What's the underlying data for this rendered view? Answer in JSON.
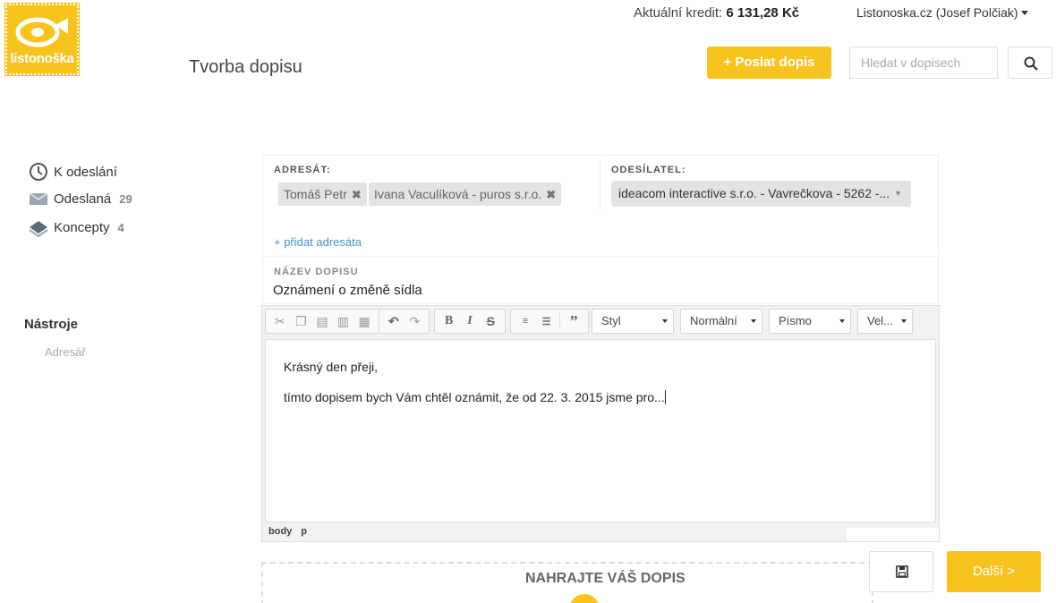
{
  "app": {
    "logo_text": "listonoška",
    "page_title": "Tvorba dopisu"
  },
  "header": {
    "credit_label": "Aktuální kredit:",
    "credit_value": "6 131,28 Kč",
    "account": "Listonoska.cz (Josef Polčiak)",
    "send_button": "+ Poslat dopis",
    "search_placeholder": "Hledat v dopisech"
  },
  "sidebar": {
    "items": [
      {
        "label": "K odeslání",
        "count": "",
        "icon": "clock-icon"
      },
      {
        "label": "Odeslaná",
        "count": "29",
        "icon": "envelope-icon"
      },
      {
        "label": "Koncepty",
        "count": "4",
        "icon": "drafts-icon"
      }
    ],
    "tools_title": "Nástroje",
    "tools_link": "Adresář"
  },
  "form": {
    "recipient_label": "ADRESÁT:",
    "recipients": [
      "Tomáš Petr",
      "Ivana Vaculíková - puros s.r.o."
    ],
    "sender_label": "ODESÍLATEL:",
    "sender_value": "ideacom interactive s.r.o. - Vavrečkova - 5262 -...",
    "add_recipient": "+ přidat adresáta",
    "subject_label": "NÁZEV DOPISU",
    "subject_value": "Oznámení o změně sídla"
  },
  "editor": {
    "combos": [
      "Styl",
      "Normální",
      "Písmo",
      "Vel..."
    ],
    "body_lines": [
      "Krásný den přeji,",
      "tímto dopisem bych Vám chtěl oznámit, že od 22. 3. 2015 jsme pro..."
    ],
    "path": [
      "body",
      "p"
    ]
  },
  "footer": {
    "upload_title": "NAHRAJTE VÁŠ DOPIS",
    "next_button": "Další >"
  },
  "colors": {
    "accent": "#f7c31d",
    "link": "#4a90c8"
  }
}
